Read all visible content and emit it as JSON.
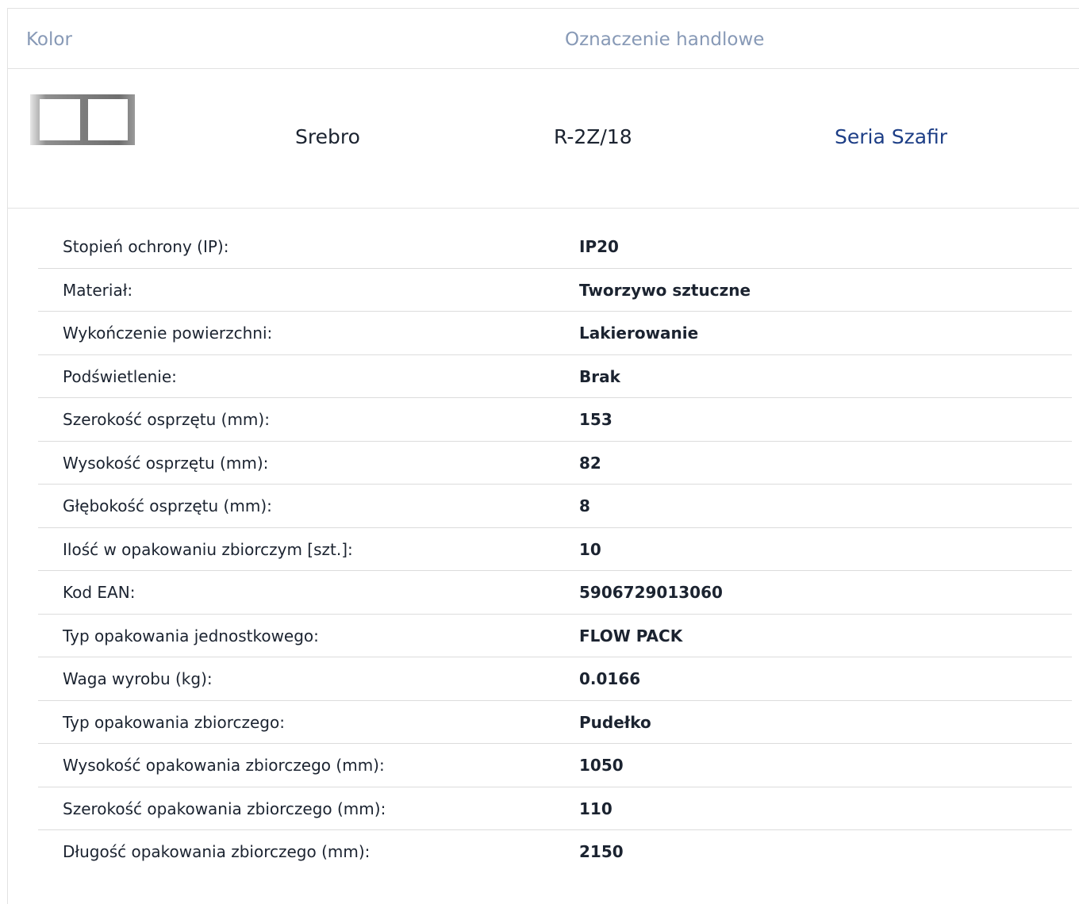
{
  "header": {
    "color_label": "Kolor",
    "trade_label": "Oznaczenie handlowe"
  },
  "product": {
    "color": "Srebro",
    "code": "R-2Z/18",
    "series_link": "Seria Szafir",
    "swatch_icon": "double-frame-silver-icon",
    "series_link_color": "#1d3e86"
  },
  "specs": [
    {
      "label": "Stopień ochrony (IP):",
      "value": "IP20"
    },
    {
      "label": "Materiał:",
      "value": "Tworzywo sztuczne"
    },
    {
      "label": "Wykończenie powierzchni:",
      "value": "Lakierowanie"
    },
    {
      "label": "Podświetlenie:",
      "value": "Brak"
    },
    {
      "label": "Szerokość osprzętu (mm):",
      "value": "153"
    },
    {
      "label": "Wysokość osprzętu (mm):",
      "value": "82"
    },
    {
      "label": "Głębokość osprzętu (mm):",
      "value": "8"
    },
    {
      "label": "Ilość w opakowaniu zbiorczym [szt.]:",
      "value": "10"
    },
    {
      "label": "Kod EAN:",
      "value": "5906729013060"
    },
    {
      "label": "Typ opakowania jednostkowego:",
      "value": "FLOW PACK"
    },
    {
      "label": "Waga wyrobu (kg):",
      "value": "0.0166"
    },
    {
      "label": "Typ opakowania zbiorczego:",
      "value": "Pudełko"
    },
    {
      "label": "Wysokość opakowania zbiorczego (mm):",
      "value": "1050"
    },
    {
      "label": "Szerokość opakowania zbiorczego (mm):",
      "value": "110"
    },
    {
      "label": "Długość opakowania zbiorczego (mm):",
      "value": "2150"
    }
  ]
}
